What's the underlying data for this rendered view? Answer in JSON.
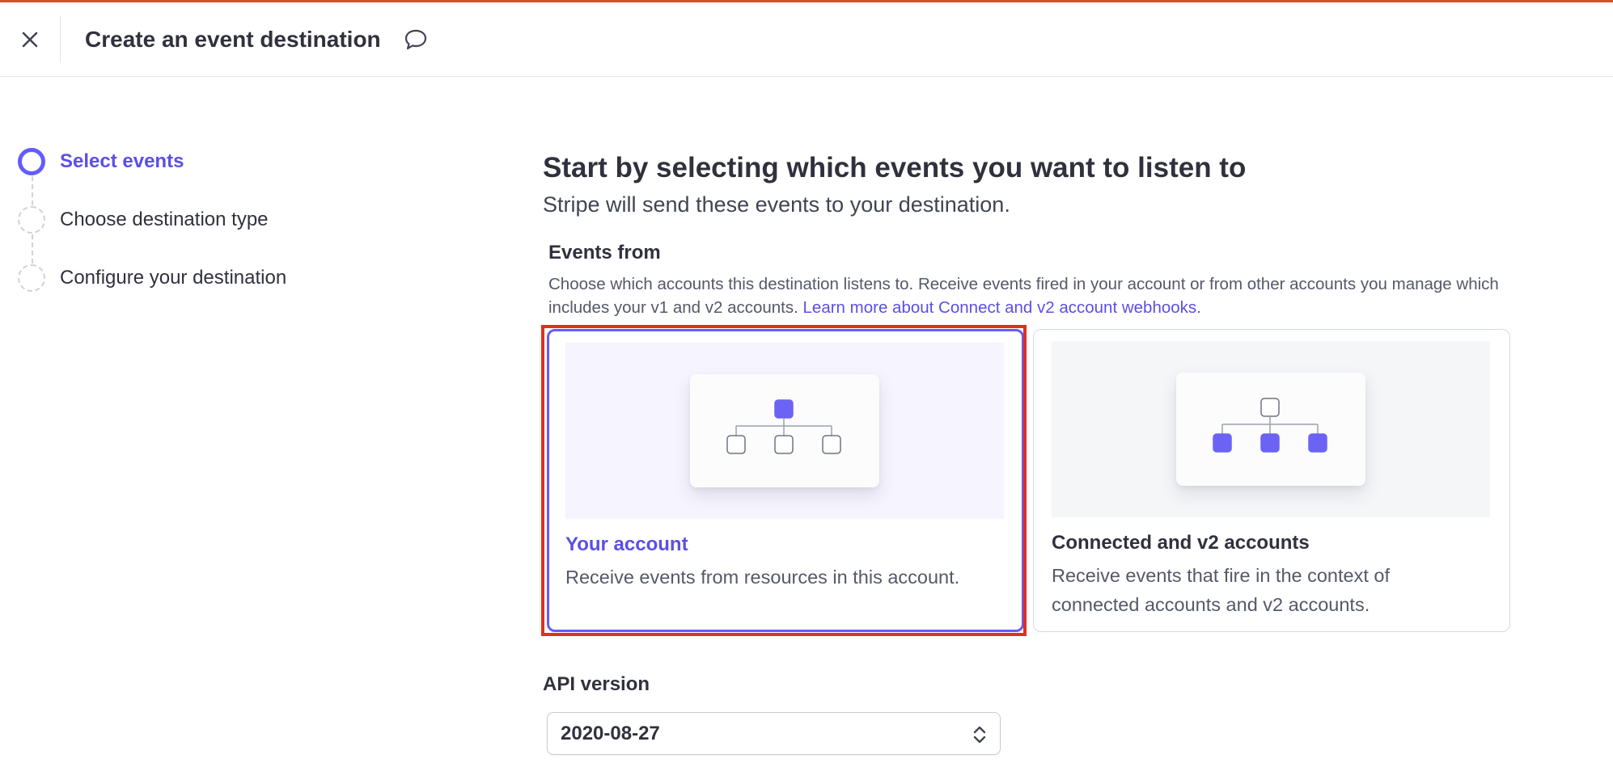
{
  "header": {
    "title": "Create an event destination",
    "close_icon": "close-icon",
    "feedback_icon": "speech-bubble-icon"
  },
  "stepper": {
    "steps": [
      {
        "label": "Select events",
        "state": "active"
      },
      {
        "label": "Choose destination type",
        "state": "pending"
      },
      {
        "label": "Configure your destination",
        "state": "pending"
      }
    ]
  },
  "main": {
    "title": "Start by selecting which events you want to listen to",
    "subtitle": "Stripe will send these events to your destination.",
    "events_from": {
      "label": "Events from",
      "description": "Choose which accounts this destination listens to. Receive events fired in your account or from other accounts you manage which includes your v1 and v2 accounts.",
      "link_text": "Learn more about Connect and v2 account webhooks."
    },
    "cards": [
      {
        "title": "Your account",
        "description": "Receive events from resources in this account.",
        "selected": true
      },
      {
        "title": "Connected and v2 accounts",
        "description": "Receive events that fire in the context of connected accounts and v2 accounts.",
        "selected": false
      }
    ],
    "api_version": {
      "label": "API version",
      "value": "2020-08-27"
    }
  },
  "colors": {
    "accent": "#635bff",
    "accent_text": "#5b4fe6",
    "top_bar": "#d4522a",
    "highlight": "#e0301e"
  }
}
